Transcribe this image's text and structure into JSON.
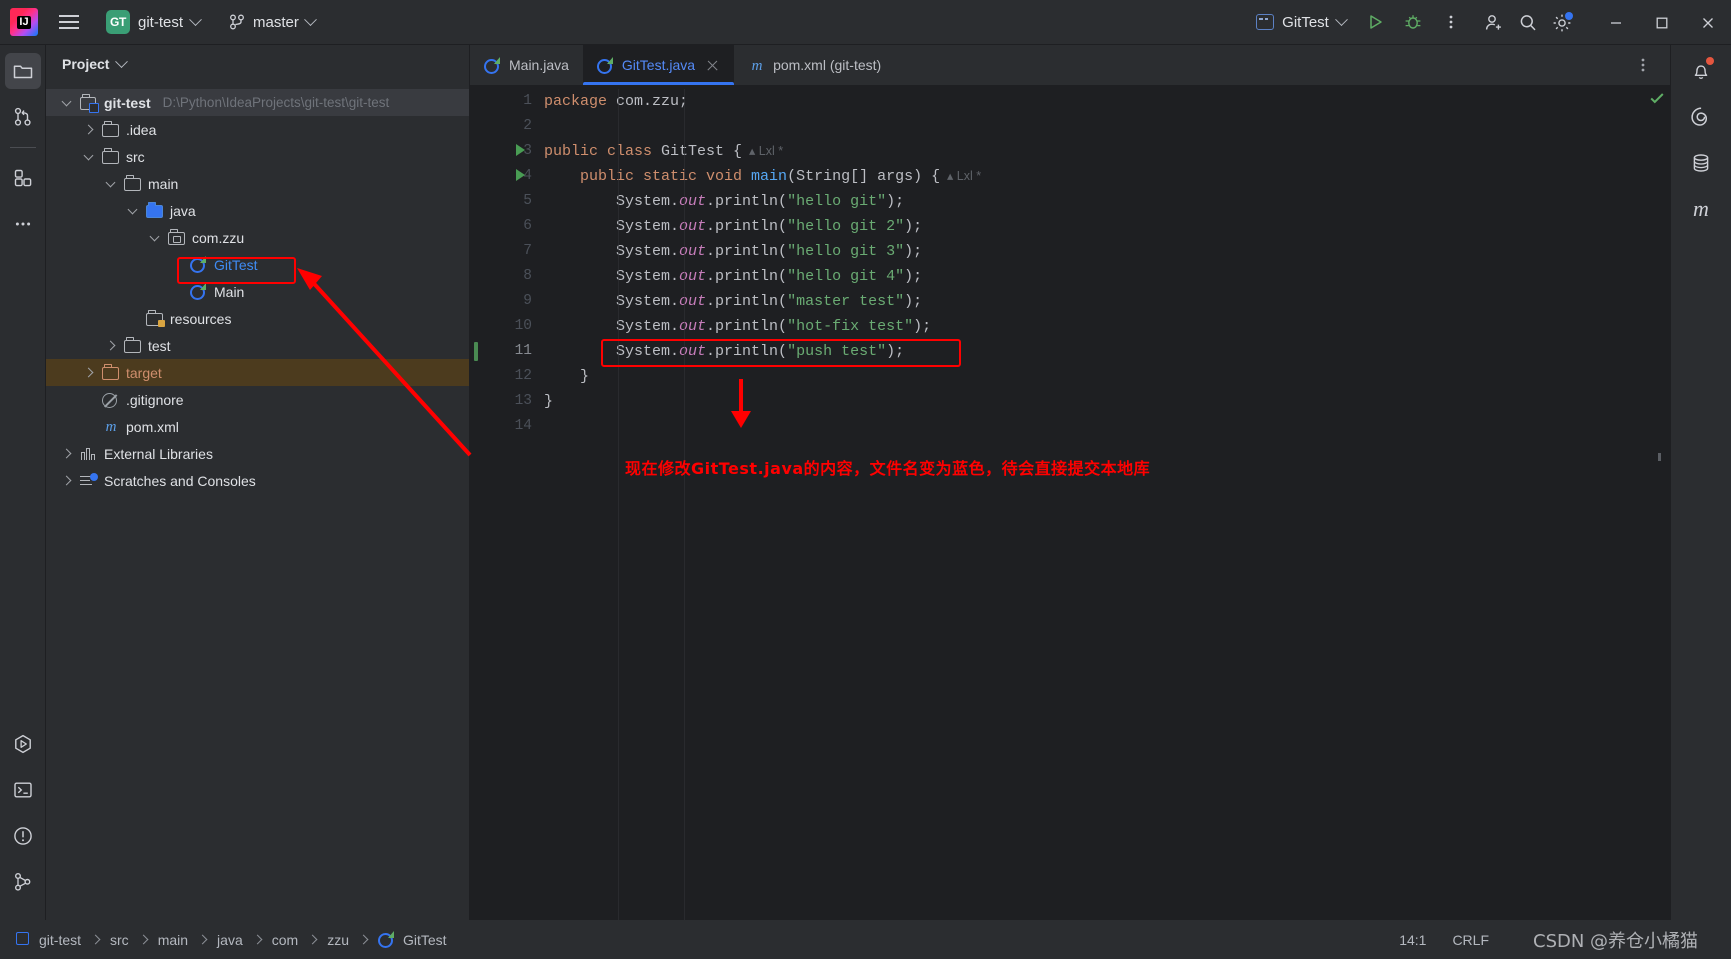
{
  "titlebar": {
    "menu_icon": "hamburger-icon",
    "project_badge": "GT",
    "project_name": "git-test",
    "branch_icon": "git-branch-icon",
    "branch_name": "master",
    "run_config": "GitTest",
    "run_icon": "run-icon",
    "debug_icon": "debug-icon",
    "more_icon": "more-vertical-icon",
    "add_user_icon": "add-user-icon",
    "search_icon": "search-icon",
    "settings_icon": "gear-icon",
    "minimize_icon": "minimize-icon",
    "maximize_icon": "maximize-icon",
    "close_icon": "close-icon"
  },
  "left_stripe": {
    "items": [
      {
        "name": "project-tool-window",
        "icon": "folder-icon",
        "active": true
      },
      {
        "name": "version-control-tool-window",
        "icon": "git-branch-icon",
        "active": false
      },
      {
        "name": "plugins-tool-window",
        "icon": "squares-icon",
        "active": false
      },
      {
        "name": "more-tool-windows",
        "icon": "more-horizontal-icon",
        "active": false
      }
    ],
    "bottom_items": [
      {
        "name": "run-tool-window",
        "icon": "run-hex-icon"
      },
      {
        "name": "terminal-tool-window",
        "icon": "terminal-icon"
      },
      {
        "name": "problems-tool-window",
        "icon": "warning-circle-icon"
      },
      {
        "name": "git-tool-window",
        "icon": "git-icon"
      }
    ]
  },
  "project_panel": {
    "title": "Project",
    "title_chevron": "chevron-down-icon",
    "tree": [
      {
        "label": "git-test",
        "suffix": "D:\\Python\\IdeaProjects\\git-test\\git-test",
        "indent": 0,
        "arrow": "down",
        "icon": "project-root-icon",
        "style": "bold",
        "state": "selected"
      },
      {
        "label": ".idea",
        "indent": 1,
        "arrow": "right",
        "icon": "folder-icon",
        "style": "normal"
      },
      {
        "label": "src",
        "indent": 1,
        "arrow": "down",
        "icon": "folder-icon",
        "style": "normal"
      },
      {
        "label": "main",
        "indent": 2,
        "arrow": "down",
        "icon": "folder-icon",
        "style": "normal"
      },
      {
        "label": "java",
        "indent": 3,
        "arrow": "down",
        "icon": "source-folder-icon",
        "style": "normal"
      },
      {
        "label": "com.zzu",
        "indent": 4,
        "arrow": "down",
        "icon": "package-icon",
        "style": "normal"
      },
      {
        "label": "GitTest",
        "indent": 5,
        "arrow": "none",
        "icon": "java-class-icon",
        "style": "blue",
        "highlight_box": true
      },
      {
        "label": "Main",
        "indent": 5,
        "arrow": "none",
        "icon": "java-class-icon",
        "style": "normal"
      },
      {
        "label": "resources",
        "indent": 3,
        "arrow": "none",
        "icon": "resources-folder-icon",
        "style": "normal"
      },
      {
        "label": "test",
        "indent": 2,
        "arrow": "right",
        "icon": "folder-icon",
        "style": "normal"
      },
      {
        "label": "target",
        "indent": 1,
        "arrow": "right",
        "icon": "excluded-folder-icon",
        "style": "amber",
        "state": "amber"
      },
      {
        "label": ".gitignore",
        "indent": 1,
        "arrow": "none",
        "icon": "gitignore-icon",
        "style": "normal"
      },
      {
        "label": "pom.xml",
        "indent": 1,
        "arrow": "none",
        "icon": "maven-icon",
        "style": "normal"
      },
      {
        "label": "External Libraries",
        "indent": 0,
        "arrow": "right",
        "icon": "library-icon",
        "style": "normal"
      },
      {
        "label": "Scratches and Consoles",
        "indent": 0,
        "arrow": "right",
        "icon": "scratches-icon",
        "style": "normal"
      }
    ]
  },
  "editor": {
    "tabs": [
      {
        "label": "Main.java",
        "icon": "java-class-icon",
        "active": false,
        "closable": false
      },
      {
        "label": "GitTest.java",
        "icon": "java-class-icon",
        "active": true,
        "closable": true
      },
      {
        "label": "pom.xml (git-test)",
        "icon": "maven-icon",
        "active": false,
        "closable": false
      }
    ],
    "tab_options_icon": "more-vertical-icon",
    "inspection_status_icon": "checkmark-ok-icon",
    "line_count": 14,
    "current_line": 11,
    "lines": [
      {
        "n": 1,
        "tokens": [
          {
            "t": "package",
            "c": "k"
          },
          {
            "t": " com.zzu;",
            "c": "pl"
          }
        ]
      },
      {
        "n": 2,
        "tokens": []
      },
      {
        "n": 3,
        "run_marker": true,
        "tokens": [
          {
            "t": "public class ",
            "c": "k"
          },
          {
            "t": "GitTest",
            "c": "cls"
          },
          {
            "t": " {",
            "c": "pl"
          }
        ],
        "hint": "Lxl *"
      },
      {
        "n": 4,
        "run_marker": true,
        "tokens": [
          {
            "t": "    public static void ",
            "c": "k"
          },
          {
            "t": "main",
            "c": "fn"
          },
          {
            "t": "(String[] args) {",
            "c": "pl"
          }
        ],
        "hint": "Lxl *"
      },
      {
        "n": 5,
        "tokens": [
          {
            "t": "        System.",
            "c": "pl"
          },
          {
            "t": "out",
            "c": "st"
          },
          {
            "t": ".println(",
            "c": "pl"
          },
          {
            "t": "\"hello git\"",
            "c": "str"
          },
          {
            "t": ");",
            "c": "pl"
          }
        ]
      },
      {
        "n": 6,
        "tokens": [
          {
            "t": "        System.",
            "c": "pl"
          },
          {
            "t": "out",
            "c": "st"
          },
          {
            "t": ".println(",
            "c": "pl"
          },
          {
            "t": "\"hello git 2\"",
            "c": "str"
          },
          {
            "t": ");",
            "c": "pl"
          }
        ]
      },
      {
        "n": 7,
        "tokens": [
          {
            "t": "        System.",
            "c": "pl"
          },
          {
            "t": "out",
            "c": "st"
          },
          {
            "t": ".println(",
            "c": "pl"
          },
          {
            "t": "\"hello git 3\"",
            "c": "str"
          },
          {
            "t": ");",
            "c": "pl"
          }
        ]
      },
      {
        "n": 8,
        "tokens": [
          {
            "t": "        System.",
            "c": "pl"
          },
          {
            "t": "out",
            "c": "st"
          },
          {
            "t": ".println(",
            "c": "pl"
          },
          {
            "t": "\"hello git 4\"",
            "c": "str"
          },
          {
            "t": ");",
            "c": "pl"
          }
        ]
      },
      {
        "n": 9,
        "tokens": [
          {
            "t": "        System.",
            "c": "pl"
          },
          {
            "t": "out",
            "c": "st"
          },
          {
            "t": ".println(",
            "c": "pl"
          },
          {
            "t": "\"master test\"",
            "c": "str"
          },
          {
            "t": ");",
            "c": "pl"
          }
        ]
      },
      {
        "n": 10,
        "tokens": [
          {
            "t": "        System.",
            "c": "pl"
          },
          {
            "t": "out",
            "c": "st"
          },
          {
            "t": ".println(",
            "c": "pl"
          },
          {
            "t": "\"hot-fix test\"",
            "c": "str"
          },
          {
            "t": ");",
            "c": "pl"
          }
        ]
      },
      {
        "n": 11,
        "changed": true,
        "highlight_box": true,
        "tokens": [
          {
            "t": "        System.",
            "c": "pl"
          },
          {
            "t": "out",
            "c": "st"
          },
          {
            "t": ".println(",
            "c": "pl"
          },
          {
            "t": "\"push test\"",
            "c": "str"
          },
          {
            "t": ");",
            "c": "pl"
          }
        ]
      },
      {
        "n": 12,
        "tokens": [
          {
            "t": "    }",
            "c": "pl"
          }
        ]
      },
      {
        "n": 13,
        "tokens": [
          {
            "t": "}",
            "c": "pl"
          }
        ]
      },
      {
        "n": 14,
        "tokens": []
      }
    ]
  },
  "right_stripe": {
    "items": [
      {
        "name": "notifications",
        "icon": "bell-icon",
        "badge": true
      },
      {
        "name": "ai-assistant",
        "icon": "spiral-icon",
        "badge": false
      },
      {
        "name": "database",
        "icon": "database-icon",
        "badge": false
      },
      {
        "name": "maven",
        "icon": "maven-m-icon",
        "badge": false
      }
    ]
  },
  "statusbar": {
    "breadcrumbs": [
      "git-test",
      "src",
      "main",
      "java",
      "com",
      "zzu",
      "GitTest"
    ],
    "breadcrumb_leading_icon": "module-icon",
    "breadcrumb_trailing_icon": "java-class-icon",
    "caret_position": "14:1",
    "line_separator": "CRLF"
  },
  "annotations": {
    "note": "现在修改GitTest.java的内容，文件名变为蓝色，待会直接提交本地库",
    "color": "#ff0000"
  },
  "watermark": {
    "text": "CSDN @养仓小橘猫"
  }
}
